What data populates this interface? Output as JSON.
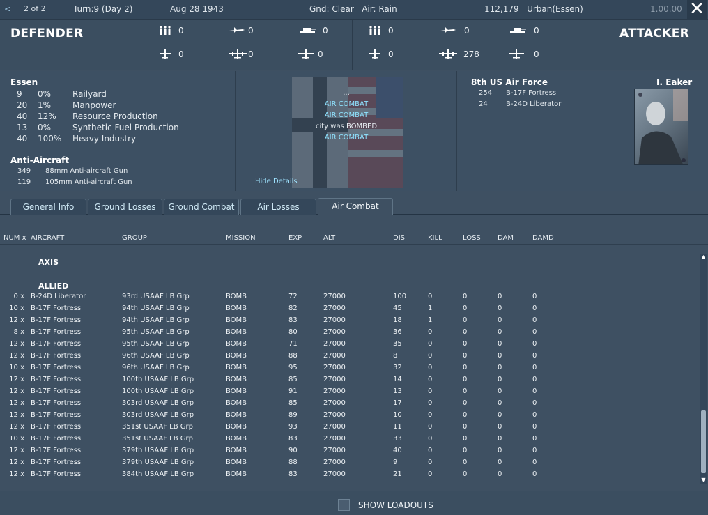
{
  "topbar": {
    "back": "<",
    "page": "2 of 2",
    "turn": "Turn:9 (Day 2)",
    "date": "Aug 28 1943",
    "weather": "Gnd: Clear   Air: Rain",
    "location": "112,179   Urban(Essen)",
    "version": "1.00.00",
    "close": "✕"
  },
  "defender": {
    "title": "DEFENDER",
    "units": {
      "infantry": "0",
      "fighter": "0",
      "tank": "0",
      "ju87": "0",
      "bomber": "0",
      "fighter2": "0"
    }
  },
  "attacker": {
    "title": "ATTACKER",
    "units": {
      "infantry": "0",
      "fighter": "0",
      "tank": "0",
      "ju87": "0",
      "bomber": "278",
      "fighter2": "0"
    }
  },
  "left_panel": {
    "city": "Essen",
    "targets": [
      {
        "n": "9",
        "pct": "0%",
        "name": "Railyard"
      },
      {
        "n": "20",
        "pct": "1%",
        "name": "Manpower"
      },
      {
        "n": "40",
        "pct": "12%",
        "name": "Resource Production"
      },
      {
        "n": "13",
        "pct": "0%",
        "name": "Synthetic Fuel Production"
      },
      {
        "n": "40",
        "pct": "100%",
        "name": "Heavy Industry"
      }
    ],
    "aa_title": "Anti-Aircraft",
    "aa": [
      {
        "n": "349",
        "name": "88mm Anti-aircraft Gun"
      },
      {
        "n": "119",
        "name": "105mm Anti-aircraft Gun"
      }
    ]
  },
  "mid_panel": {
    "events": [
      "...",
      "AIR COMBAT",
      "AIR COMBAT",
      "city was BOMBED",
      "AIR COMBAT"
    ],
    "hide_details": "Hide Details"
  },
  "right_panel": {
    "force": "8th US Air Force",
    "commander": "I. Eaker",
    "units": [
      {
        "n": "254",
        "name": "B-17F Fortress"
      },
      {
        "n": "24",
        "name": "B-24D Liberator"
      }
    ]
  },
  "tabs": [
    "General Info",
    "Ground Losses",
    "Ground Combat",
    "Air Losses",
    "Air Combat"
  ],
  "table": {
    "headers": [
      "NUM x",
      "AIRCRAFT",
      "GROUP",
      "MISSION",
      "EXP",
      "ALT",
      "DIS",
      "KILL",
      "LOSS",
      "DAM",
      "DAMD"
    ],
    "axis_label": "AXIS",
    "allied_label": "ALLIED",
    "rows": [
      [
        "0 x",
        "B-24D Liberator",
        "93rd USAAF LB Grp",
        "BOMB",
        "72",
        "27000",
        "100",
        "0",
        "0",
        "0",
        "0"
      ],
      [
        "10 x",
        "B-17F Fortress",
        "94th USAAF LB Grp",
        "BOMB",
        "82",
        "27000",
        "45",
        "1",
        "0",
        "0",
        "0"
      ],
      [
        "12 x",
        "B-17F Fortress",
        "94th USAAF LB Grp",
        "BOMB",
        "83",
        "27000",
        "18",
        "1",
        "0",
        "0",
        "0"
      ],
      [
        "8 x",
        "B-17F Fortress",
        "95th USAAF LB Grp",
        "BOMB",
        "80",
        "27000",
        "36",
        "0",
        "0",
        "0",
        "0"
      ],
      [
        "12 x",
        "B-17F Fortress",
        "95th USAAF LB Grp",
        "BOMB",
        "71",
        "27000",
        "35",
        "0",
        "0",
        "0",
        "0"
      ],
      [
        "12 x",
        "B-17F Fortress",
        "96th USAAF LB Grp",
        "BOMB",
        "88",
        "27000",
        "8",
        "0",
        "0",
        "0",
        "0"
      ],
      [
        "10 x",
        "B-17F Fortress",
        "96th USAAF LB Grp",
        "BOMB",
        "95",
        "27000",
        "32",
        "0",
        "0",
        "0",
        "0"
      ],
      [
        "12 x",
        "B-17F Fortress",
        "100th USAAF LB Grp",
        "BOMB",
        "85",
        "27000",
        "14",
        "0",
        "0",
        "0",
        "0"
      ],
      [
        "12 x",
        "B-17F Fortress",
        "100th USAAF LB Grp",
        "BOMB",
        "91",
        "27000",
        "13",
        "0",
        "0",
        "0",
        "0"
      ],
      [
        "12 x",
        "B-17F Fortress",
        "303rd USAAF LB Grp",
        "BOMB",
        "85",
        "27000",
        "17",
        "0",
        "0",
        "0",
        "0"
      ],
      [
        "12 x",
        "B-17F Fortress",
        "303rd USAAF LB Grp",
        "BOMB",
        "89",
        "27000",
        "10",
        "0",
        "0",
        "0",
        "0"
      ],
      [
        "12 x",
        "B-17F Fortress",
        "351st USAAF LB Grp",
        "BOMB",
        "93",
        "27000",
        "11",
        "0",
        "0",
        "0",
        "0"
      ],
      [
        "10 x",
        "B-17F Fortress",
        "351st USAAF LB Grp",
        "BOMB",
        "83",
        "27000",
        "33",
        "0",
        "0",
        "0",
        "0"
      ],
      [
        "12 x",
        "B-17F Fortress",
        "379th USAAF LB Grp",
        "BOMB",
        "90",
        "27000",
        "40",
        "0",
        "0",
        "0",
        "0"
      ],
      [
        "12 x",
        "B-17F Fortress",
        "379th USAAF LB Grp",
        "BOMB",
        "88",
        "27000",
        "9",
        "0",
        "0",
        "0",
        "0"
      ],
      [
        "12 x",
        "B-17F Fortress",
        "384th USAAF LB Grp",
        "BOMB",
        "83",
        "27000",
        "21",
        "0",
        "0",
        "0",
        "0"
      ]
    ]
  },
  "footer": {
    "show_loadouts": "SHOW LOADOUTS"
  }
}
